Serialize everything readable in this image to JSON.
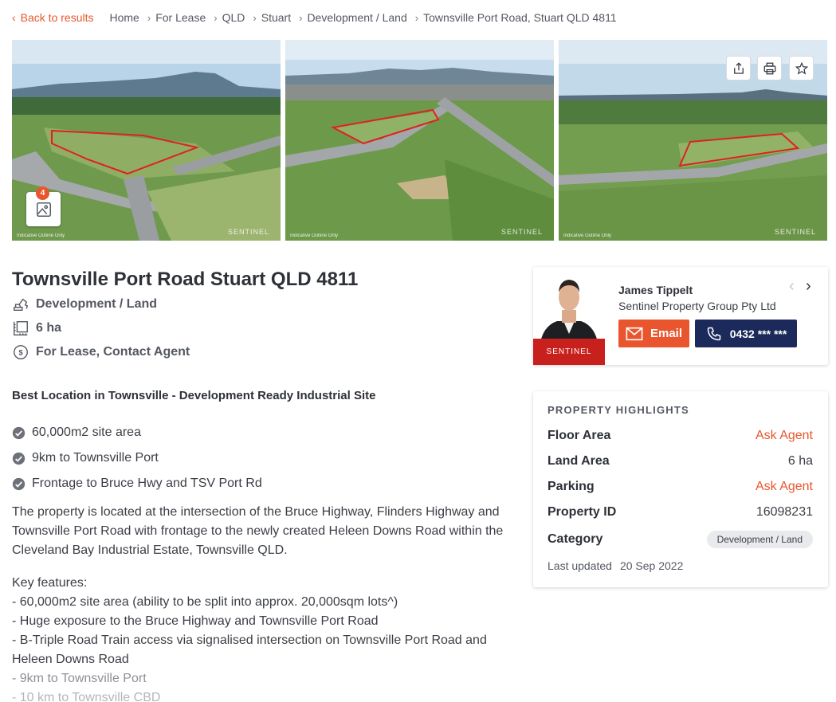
{
  "breadcrumb": {
    "back_label": "Back to results",
    "items": [
      "Home",
      "For Lease",
      "QLD",
      "Stuart",
      "Development / Land",
      "Townsville Port Road, Stuart QLD 4811"
    ]
  },
  "gallery": {
    "photo_count": "4",
    "photo_caption": "Indicative Outline Only"
  },
  "listing": {
    "title": "Townsville Port Road Stuart QLD 4811",
    "property_type": "Development / Land",
    "land_size": "6 ha",
    "price": "For Lease, Contact Agent",
    "headline": "Best Location in Townsville - Development Ready Industrial Site",
    "bullets": [
      "60,000m2 site area",
      "9km to Townsville Port",
      "Frontage to Bruce Hwy and TSV Port Rd"
    ],
    "description": "The property is located at the intersection of the Bruce Highway, Flinders Highway and Townsville Port Road with frontage to the newly created Heleen Downs Road within the Cleveland Bay Industrial Estate, Townsville QLD.",
    "features_heading": "Key features:",
    "features": [
      "- 60,000m2 site area (ability to be split into approx. 20,000sqm lots^)",
      "- Huge exposure to the Bruce Highway and Townsville Port Road",
      "- B-Triple Road Train access via signalised intersection on Townsville Port Road and Heleen Downs Road",
      "- 9km to Townsville Port",
      "- 10 km to Townsville CBD"
    ]
  },
  "agent": {
    "name": "James Tippelt",
    "agency": "Sentinel Property Group Pty Ltd",
    "agency_logo_text": "SENTINEL",
    "email_label": "Email",
    "phone_label": "0432 *** ***"
  },
  "highlights": {
    "title": "PROPERTY HIGHLIGHTS",
    "floor_area_label": "Floor Area",
    "floor_area_value": "Ask Agent",
    "land_area_label": "Land Area",
    "land_area_value": "6 ha",
    "parking_label": "Parking",
    "parking_value": "Ask Agent",
    "property_id_label": "Property ID",
    "property_id_value": "16098231",
    "category_label": "Category",
    "category_value": "Development / Land",
    "last_updated_label": "Last updated",
    "last_updated_value": "20 Sep 2022"
  },
  "colors": {
    "accent": "#e9562e",
    "navy": "#1b2a5a"
  }
}
